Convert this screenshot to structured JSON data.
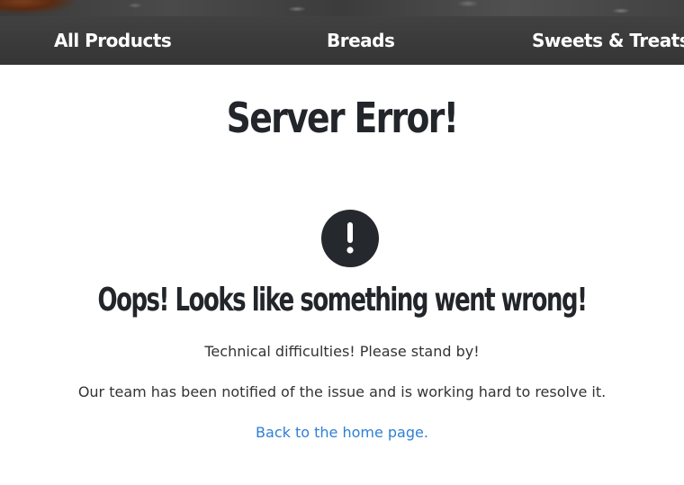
{
  "nav": {
    "items": [
      {
        "label": "All Products"
      },
      {
        "label": "Breads"
      },
      {
        "label": "Sweets & Treats"
      }
    ]
  },
  "page": {
    "title": "Server Error!",
    "icon": "exclamation-circle-icon",
    "heading": "Oops! Looks like something went wrong!",
    "message_1": "Technical difficulties! Please stand by!",
    "message_2": "Our team has been notified of the issue and is working hard to resolve it.",
    "home_link": "Back to the home page."
  },
  "colors": {
    "nav_background": "#3b3b3b",
    "nav_text": "#ffffff",
    "heading_text": "#222529",
    "icon_background": "#25282c",
    "link": "#2f7fd4"
  }
}
